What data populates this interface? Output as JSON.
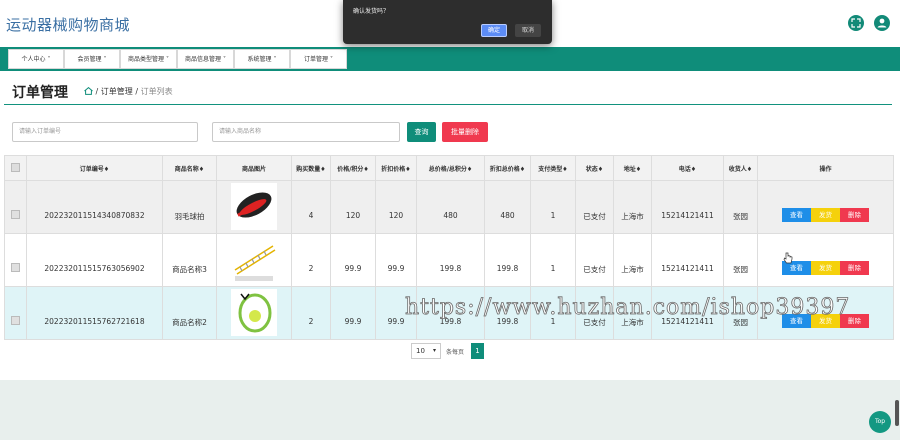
{
  "app": {
    "title": "运动器械购物商城"
  },
  "header": {
    "fullscreen_icon": "expand-icon",
    "user_icon": "user-icon"
  },
  "nav": {
    "items": [
      {
        "label": "个人中心 ˅"
      },
      {
        "label": "会员管理 ˅"
      },
      {
        "label": "商品类型管理 ˅"
      },
      {
        "label": "商品信息管理 ˅"
      },
      {
        "label": "系统管理 ˅"
      },
      {
        "label": "订单管理 ˅"
      }
    ]
  },
  "page": {
    "heading": "订单管理",
    "breadcrumb": {
      "sep": "/",
      "level1": "订单管理",
      "level2": "订单列表"
    }
  },
  "search": {
    "order_placeholder": "请输入订单编号",
    "product_placeholder": "请输入商品名称",
    "query_label": "查询",
    "batch_delete_label": "批量删除"
  },
  "colors": {
    "primary": "#0f8d7a",
    "view": "#1e8ee8",
    "ship": "#f5d10c",
    "delete": "#f0394f",
    "highlight_row": "#dff4f7"
  },
  "table": {
    "headers": [
      "",
      "订单编号♦",
      "商品名称♦",
      "商品图片",
      "购买数量♦",
      "价格/积分♦",
      "折扣价格♦",
      "总价格/总积分♦",
      "折扣总价格♦",
      "支付类型♦",
      "状态♦",
      "地址♦",
      "电话♦",
      "收货人♦",
      "操作"
    ],
    "actions": {
      "view": "查看",
      "ship": "发货",
      "delete": "删除"
    },
    "rows": [
      {
        "order_no": "20223201151434087083 2",
        "order_no_text": "202232011514340870832",
        "name": "羽毛球拍",
        "image": "badminton-racket-bag",
        "qty": "4",
        "price": "120",
        "discount": "120",
        "total": "480",
        "discount_total": "480",
        "pay_type": "1",
        "status": "已支付",
        "address": "上海市",
        "phone": "15214121411",
        "receiver": "张园"
      },
      {
        "order_no_text": "202232011515763056902",
        "name": "商品名称3",
        "image": "agility-ladder",
        "qty": "2",
        "price": "99.9",
        "discount": "99.9",
        "total": "199.8",
        "discount_total": "199.8",
        "pay_type": "1",
        "status": "已支付",
        "address": "上海市",
        "phone": "15214121411",
        "receiver": "张园"
      },
      {
        "order_no_text": "202232011515762721618",
        "name": "商品名称2",
        "image": "tennis-racket-ball",
        "qty": "2",
        "price": "99.9",
        "discount": "99.9",
        "total": "199.8",
        "discount_total": "199.8",
        "pay_type": "1",
        "status": "已支付",
        "address": "上海市",
        "phone": "15214121411",
        "receiver": "张园"
      }
    ]
  },
  "pagination": {
    "page_size": "10",
    "per_page_label": "条每页",
    "current_page": "1"
  },
  "dialog": {
    "message": "确认发货吗？",
    "ok": "确定",
    "cancel": "取消"
  },
  "watermark": "https://www.huzhan.com/ishop39397",
  "top_button": "Top"
}
